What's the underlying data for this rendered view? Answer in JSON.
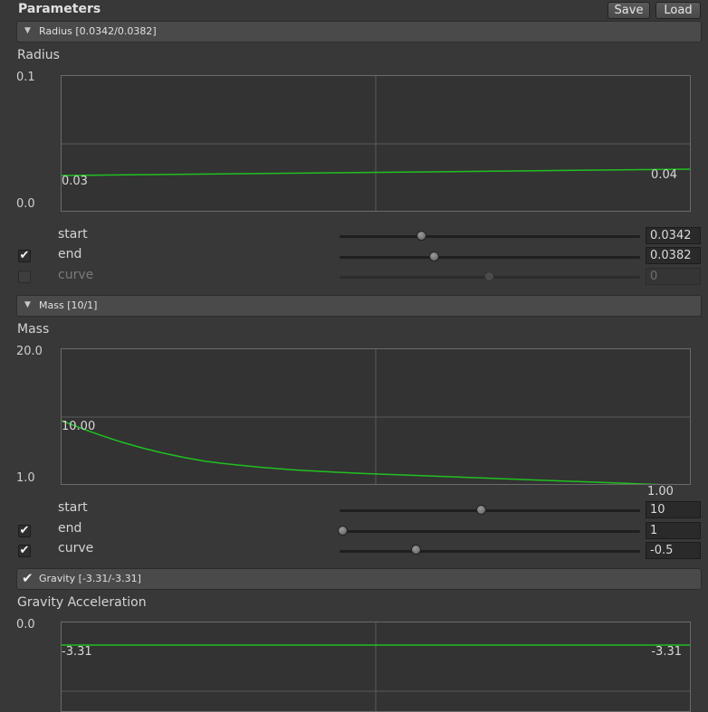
{
  "header": {
    "title": "Parameters",
    "save_label": "Save",
    "load_label": "Load"
  },
  "sections": [
    {
      "header_text": "Radius [0.0342/0.0382]",
      "label": "Radius",
      "graph": {
        "y_max": "0.1",
        "y_min": "0.0",
        "start_label": "0.03",
        "end_label": "0.04"
      },
      "params": [
        {
          "label": "start",
          "value": "0.0342",
          "checked": null,
          "slider": 0.27
        },
        {
          "label": "end",
          "value": "0.0382",
          "checked": true,
          "slider": 0.31
        },
        {
          "label": "curve",
          "value": "0",
          "checked": false,
          "slider": 0.5
        }
      ]
    },
    {
      "header_text": "Mass [10/1]",
      "label": "Mass",
      "graph": {
        "y_max": "20.0",
        "y_min": "1.0",
        "start_label": "10.00",
        "end_label": "1.00"
      },
      "params": [
        {
          "label": "start",
          "value": "10",
          "checked": null,
          "slider": 0.47
        },
        {
          "label": "end",
          "value": "1",
          "checked": true,
          "slider": 0.0
        },
        {
          "label": "curve",
          "value": "-0.5",
          "checked": true,
          "slider": 0.25
        }
      ]
    },
    {
      "header_text": "Gravity [-3.31/-3.31]",
      "label": "Gravity Acceleration",
      "graph": {
        "y_max": "0.0",
        "start_label": "-3.31",
        "end_label": "-3.31"
      }
    }
  ],
  "colors": {
    "curve": "#20c020",
    "background": "#383838",
    "header": "#4a4a4a"
  }
}
